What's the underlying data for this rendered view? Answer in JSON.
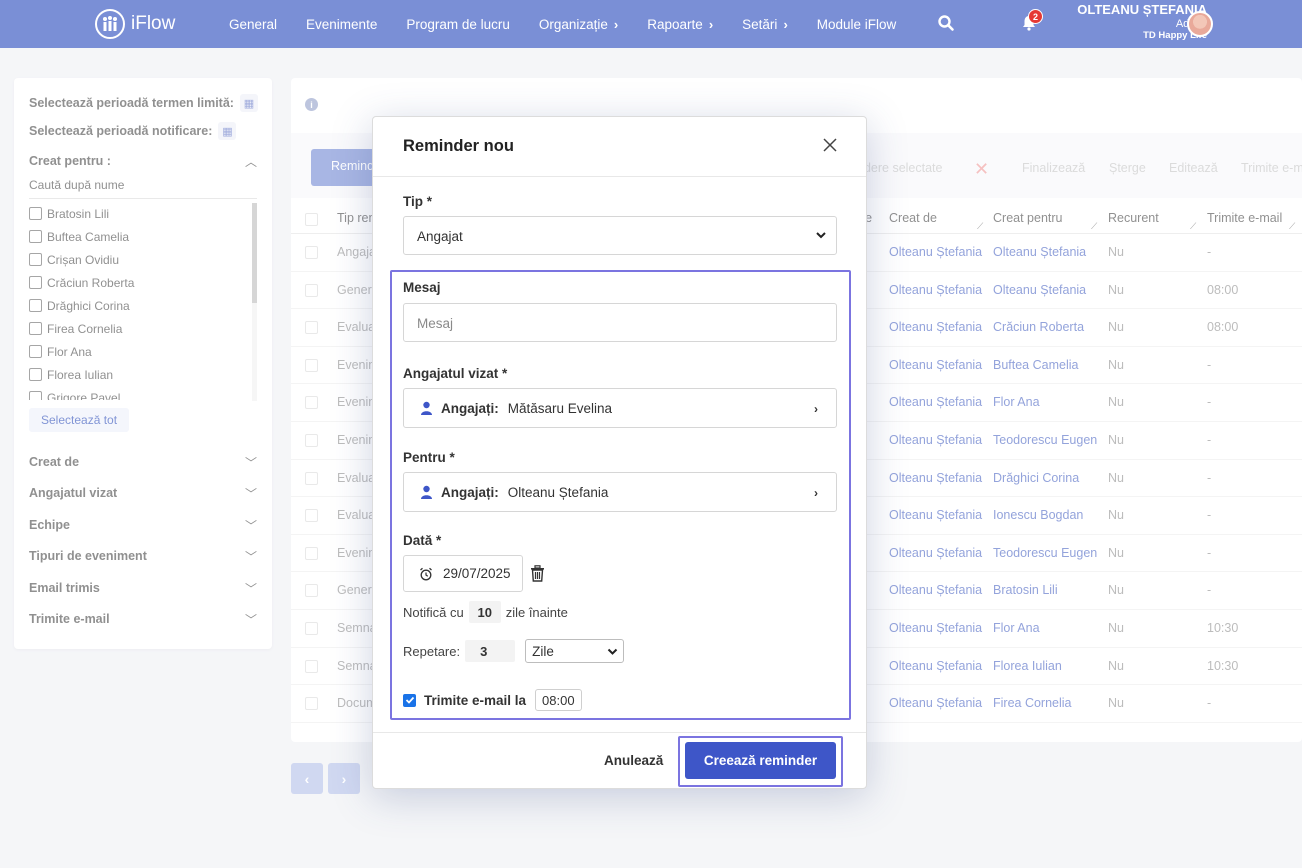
{
  "nav": {
    "brand": "iFlow",
    "items": [
      {
        "label": "General",
        "chevron": false
      },
      {
        "label": "Evenimente",
        "chevron": false
      },
      {
        "label": "Program de lucru",
        "chevron": false
      },
      {
        "label": "Organizație",
        "chevron": true
      },
      {
        "label": "Rapoarte",
        "chevron": true
      },
      {
        "label": "Setări",
        "chevron": true
      },
      {
        "label": "Module iFlow",
        "chevron": false
      }
    ],
    "notif_count": "2",
    "user_name": "OLTEANU ȘTEFANIA",
    "user_role": "Admin",
    "user_company": "TD Happy Life"
  },
  "sidebar": {
    "deadline_period": "Selectează perioadă termen limită:",
    "notify_period": "Selectează perioadă notificare:",
    "created_for": "Creat pentru :",
    "search_placeholder": "Caută după nume",
    "people": [
      "Bratosin Lili",
      "Buftea Camelia",
      "Crișan Ovidiu",
      "Crăciun Roberta",
      "Drăghici Corina",
      "Firea Cornelia",
      "Flor Ana",
      "Florea Iulian",
      "Grigore Pavel"
    ],
    "select_all": "Selectează tot",
    "filters": [
      "Creat de",
      "Angajatul vizat",
      "Echipe",
      "Tipuri de eveniment",
      "Email trimis",
      "Trimite e-mail"
    ]
  },
  "toolbar": {
    "reminder_btn": "Reminder nou",
    "selected": "ndere selectate",
    "finalize": "Finalizează",
    "delete": "Șterge",
    "edit": "Editează",
    "send_email": "Trimite e-mail"
  },
  "table": {
    "headers": {
      "tip": "Tip reminder",
      "re": "re",
      "created_by": "Creat de",
      "created_for": "Creat pentru",
      "recurrent": "Recurent",
      "send_email": "Trimite e-mail"
    },
    "rows": [
      {
        "tip": "Angajat",
        "by": "Olteanu Ștefania",
        "for": "Olteanu Ștefania",
        "rec": "Nu",
        "mail": "-"
      },
      {
        "tip": "General",
        "by": "Olteanu Ștefania",
        "for": "Olteanu Ștefania",
        "rec": "Nu",
        "mail": "08:00"
      },
      {
        "tip": "Evaluare",
        "by": "Olteanu Ștefania",
        "for": "Crăciun Roberta",
        "rec": "Nu",
        "mail": "08:00"
      },
      {
        "tip": "Eveniment",
        "by": "Olteanu Ștefania",
        "for": "Buftea Camelia",
        "rec": "Nu",
        "mail": "-"
      },
      {
        "tip": "Eveniment",
        "by": "Olteanu Ștefania",
        "for": "Flor Ana",
        "rec": "Nu",
        "mail": "-"
      },
      {
        "tip": "Eveniment",
        "by": "Olteanu Ștefania",
        "for": "Teodorescu Eugen",
        "rec": "Nu",
        "mail": "-"
      },
      {
        "tip": "Evaluare",
        "by": "Olteanu Ștefania",
        "for": "Drăghici Corina",
        "rec": "Nu",
        "mail": "-"
      },
      {
        "tip": "Evaluare",
        "by": "Olteanu Ștefania",
        "for": "Ionescu Bogdan",
        "rec": "Nu",
        "mail": "-"
      },
      {
        "tip": "Eveniment",
        "by": "Olteanu Ștefania",
        "for": "Teodorescu Eugen",
        "rec": "Nu",
        "mail": "-"
      },
      {
        "tip": "General",
        "by": "Olteanu Ștefania",
        "for": "Bratosin Lili",
        "rec": "Nu",
        "mail": "-"
      },
      {
        "tip": "Semnare",
        "by": "Olteanu Ștefania",
        "for": "Flor Ana",
        "rec": "Nu",
        "mail": "10:30"
      },
      {
        "tip": "Semnare",
        "by": "Olteanu Ștefania",
        "for": "Florea Iulian",
        "rec": "Nu",
        "mail": "10:30"
      },
      {
        "tip": "Document",
        "by": "Olteanu Ștefania",
        "for": "Firea Cornelia",
        "rec": "Nu",
        "mail": "-"
      }
    ]
  },
  "modal": {
    "title": "Reminder nou",
    "type_label": "Tip *",
    "type_value": "Angajat",
    "message_label": "Mesaj",
    "message_placeholder": "Mesaj",
    "target_label": "Angajatul vizat *",
    "target_key": "Angajați:",
    "target_value": "Mătăsaru Evelina",
    "for_label": "Pentru *",
    "for_key": "Angajați:",
    "for_value": "Olteanu Ștefania",
    "date_label": "Dată *",
    "date_value": "29/07/2025",
    "notify_prefix": "Notifică cu",
    "notify_days": "10",
    "notify_suffix": "zile înainte",
    "repeat_label": "Repetare:",
    "repeat_value": "3",
    "repeat_unit": "Zile",
    "send_email_label": "Trimite e-mail la",
    "send_email_time": "08:00",
    "cancel": "Anulează",
    "create": "Creează reminder"
  },
  "colors": {
    "accent": "#7a8fd6",
    "primary_btn": "#3e56c8",
    "highlight": "#7b74e0",
    "link": "#5a72c8"
  }
}
